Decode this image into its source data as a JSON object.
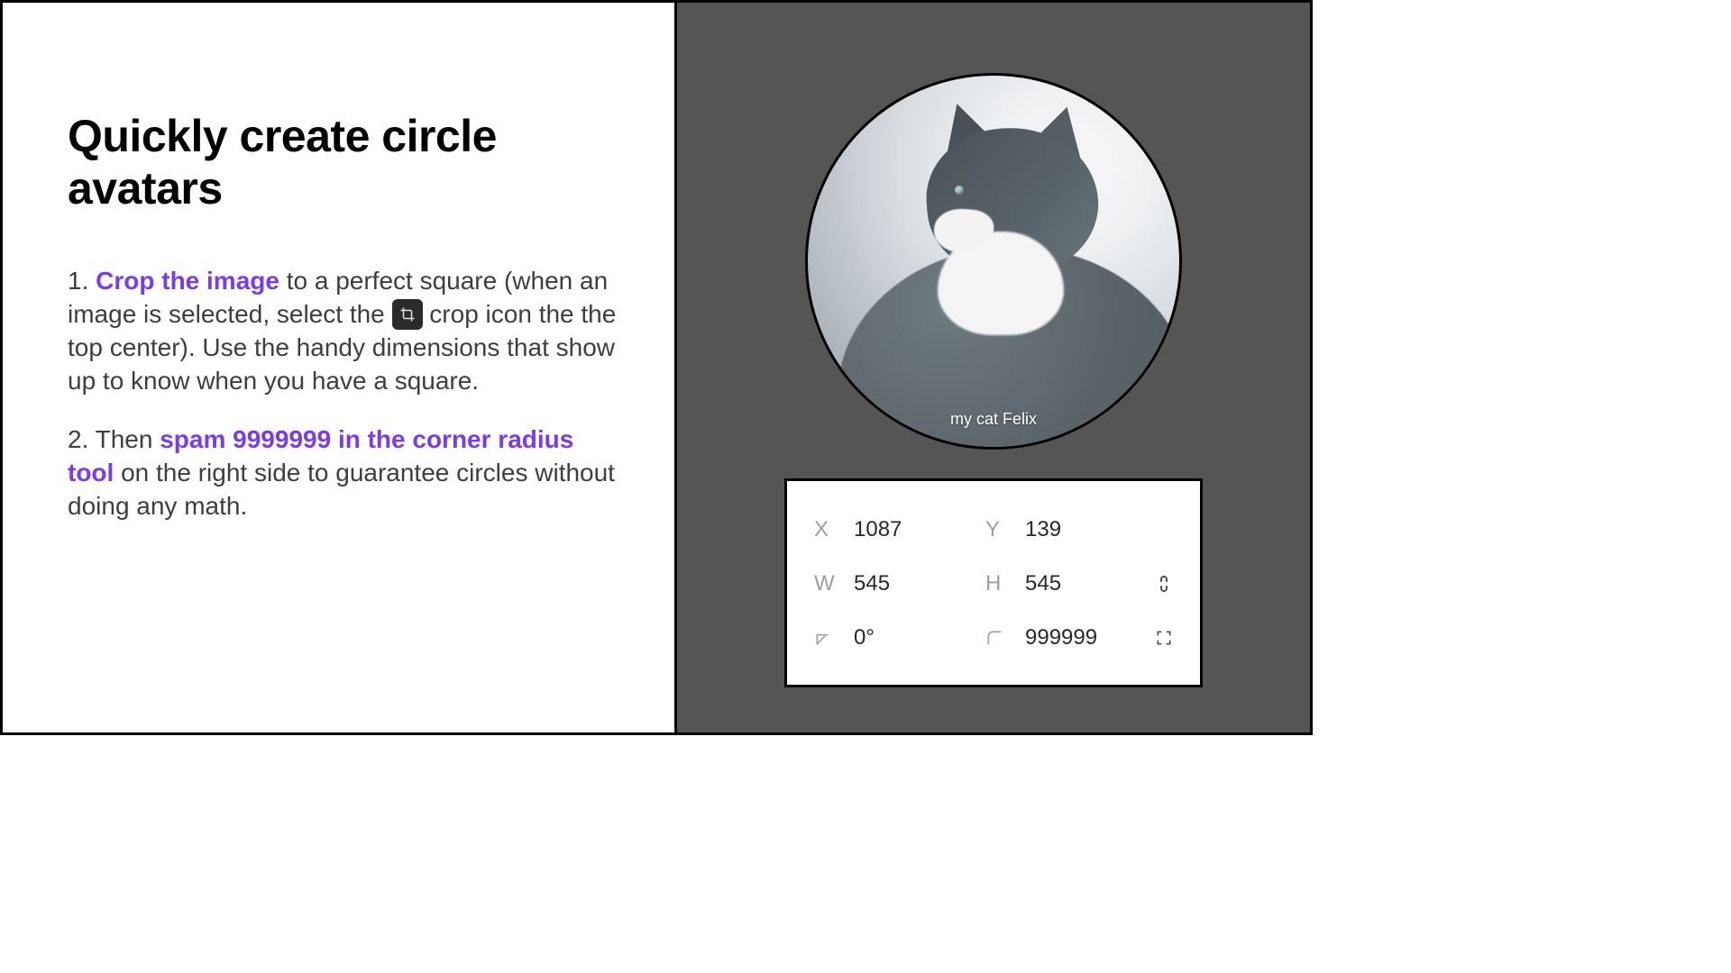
{
  "title": "Quickly create circle avatars",
  "step1": {
    "num": "1. ",
    "hl": "Crop the image",
    "rest_a": " to a perfect square (when an image is selected, select the ",
    "rest_b": " crop icon the the top center). Use the handy dimensions that show up to know when you have a square."
  },
  "step2": {
    "num": "2. Then ",
    "hl": "spam 9999999 in the corner radius tool",
    "rest": " on the right side to guarantee circles without doing any math."
  },
  "avatar_caption": "my cat Felix",
  "panel": {
    "x_label": "X",
    "x_value": "1087",
    "y_label": "Y",
    "y_value": "139",
    "w_label": "W",
    "w_value": "545",
    "h_label": "H",
    "h_value": "545",
    "rotation_value": "0°",
    "radius_value": "999999"
  },
  "colors": {
    "accent": "#7c3aed",
    "arrow": "#c026d3"
  }
}
